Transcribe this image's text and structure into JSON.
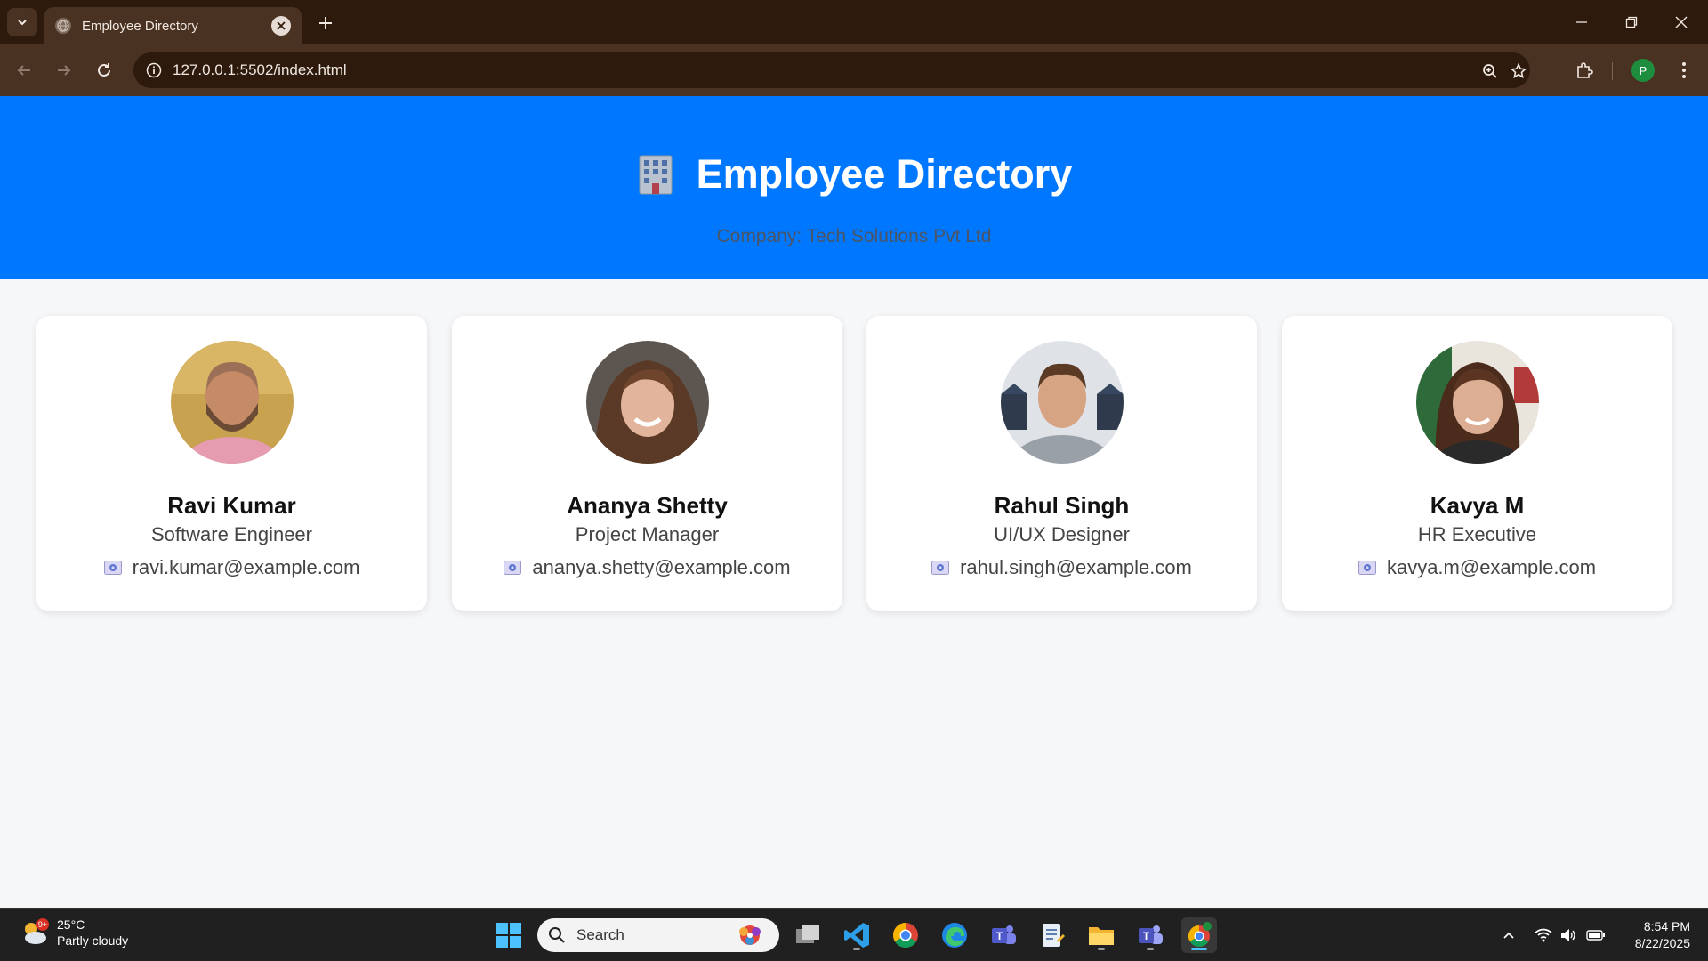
{
  "browser": {
    "tab_title": "Employee Directory",
    "url": "127.0.0.1:5502/index.html",
    "profile_initial": "P"
  },
  "page": {
    "title": "Employee Directory",
    "subtitle": "Company: Tech Solutions Pvt Ltd",
    "header_color": "#0077ff"
  },
  "employees": [
    {
      "name": "Ravi Kumar",
      "role": "Software Engineer",
      "email": "ravi.kumar@example.com"
    },
    {
      "name": "Ananya Shetty",
      "role": "Project Manager",
      "email": "ananya.shetty@example.com"
    },
    {
      "name": "Rahul Singh",
      "role": "UI/UX Designer",
      "email": "rahul.singh@example.com"
    },
    {
      "name": "Kavya M",
      "role": "HR Executive",
      "email": "kavya.m@example.com"
    }
  ],
  "taskbar": {
    "weather_temp": "25°C",
    "weather_desc": "Partly cloudy",
    "weather_badge": "9+",
    "search_placeholder": "Search",
    "time": "8:54 PM",
    "date": "8/22/2025"
  }
}
